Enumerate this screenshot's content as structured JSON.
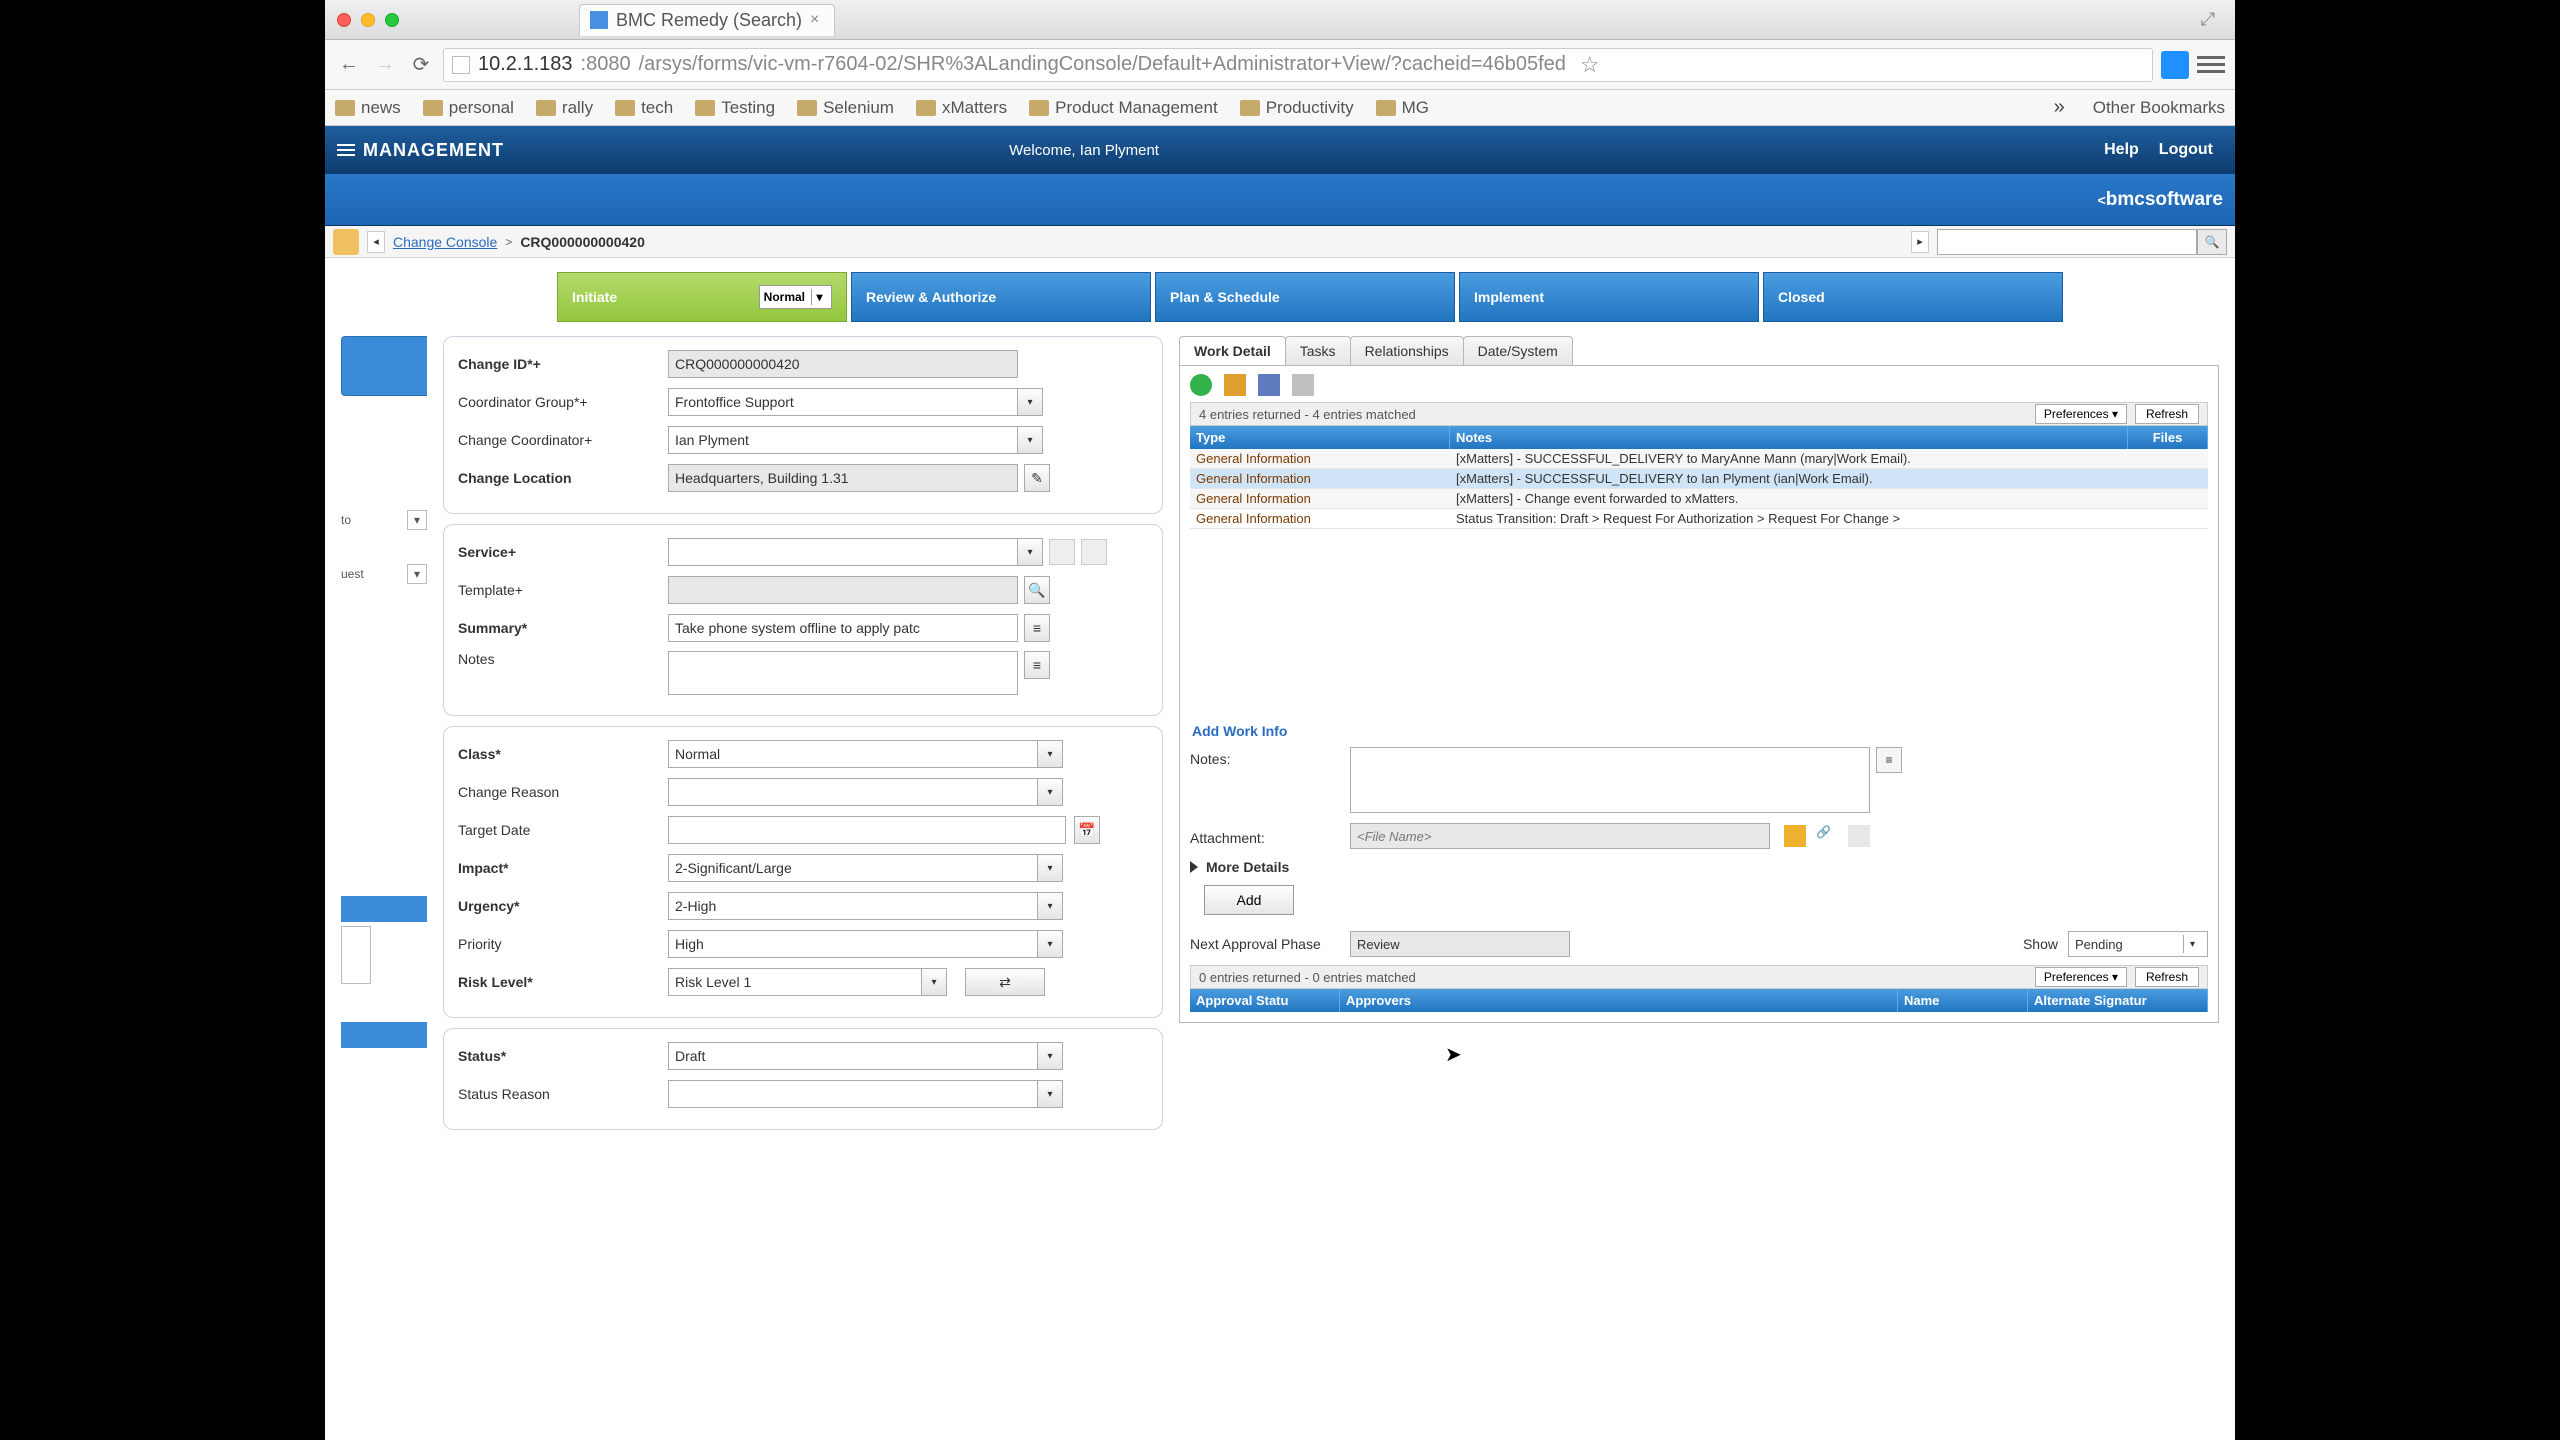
{
  "browser": {
    "tab_title": "BMC Remedy (Search)",
    "url_host": "10.2.1.183",
    "url_port": ":8080",
    "url_rest": "/arsys/forms/vic-vm-r7604-02/SHR%3ALandingConsole/Default+Administrator+View/?cacheid=46b05fed",
    "bookmarks": [
      "news",
      "personal",
      "rally",
      "tech",
      "Testing",
      "Selenium",
      "xMatters",
      "Product Management",
      "Productivity",
      "MG"
    ],
    "more_symbol": "»",
    "other_bookmarks": "Other Bookmarks"
  },
  "header": {
    "app_title": "MANAGEMENT",
    "welcome": "Welcome, Ian Plyment",
    "help": "Help",
    "logout": "Logout",
    "bmc_logo": "bmcsoftware"
  },
  "breadcrumb": {
    "link": "Change Console",
    "current": "CRQ000000000420"
  },
  "pipeline": {
    "stages": [
      "Initiate",
      "Review & Authorize",
      "Plan & Schedule",
      "Implement",
      "Closed"
    ],
    "substage_value": "Normal"
  },
  "left_form": {
    "change_id_label": "Change ID*+",
    "change_id_value": "CRQ000000000420",
    "coord_group_label": "Coordinator Group*+",
    "coord_group_value": "Frontoffice Support",
    "change_coord_label": "Change Coordinator+",
    "change_coord_value": "Ian Plyment",
    "change_loc_label": "Change Location",
    "change_loc_value": "Headquarters, Building 1.31",
    "service_label": "Service+",
    "service_value": "",
    "template_label": "Template+",
    "template_value": "",
    "summary_label": "Summary*",
    "summary_value": "Take phone system offline to apply patc",
    "notes_label": "Notes",
    "notes_value": "",
    "class_label": "Class*",
    "class_value": "Normal",
    "change_reason_label": "Change Reason",
    "change_reason_value": "",
    "target_date_label": "Target Date",
    "target_date_value": "",
    "impact_label": "Impact*",
    "impact_value": "2-Significant/Large",
    "urgency_label": "Urgency*",
    "urgency_value": "2-High",
    "priority_label": "Priority",
    "priority_value": "High",
    "risk_label": "Risk Level*",
    "risk_value": "Risk Level 1",
    "status_label": "Status*",
    "status_value": "Draft",
    "status_reason_label": "Status Reason",
    "status_reason_value": ""
  },
  "leftnav": {
    "item1": "to",
    "item2": "uest"
  },
  "right_tabs": [
    "Work Detail",
    "Tasks",
    "Relationships",
    "Date/System"
  ],
  "work_detail": {
    "count_text": "4 entries returned - 4 entries matched",
    "preferences": "Preferences ▾",
    "refresh": "Refresh",
    "headers": {
      "c1": "Type",
      "c2": "Notes",
      "c3": "Files"
    },
    "rows": [
      {
        "type": "General Information",
        "notes": "[xMatters] - SUCCESSFUL_DELIVERY to MaryAnne Mann (mary|Work Email)."
      },
      {
        "type": "General Information",
        "notes": "[xMatters] - SUCCESSFUL_DELIVERY to Ian Plyment (ian|Work Email).",
        "hl": true
      },
      {
        "type": "General Information",
        "notes": "[xMatters] - Change event forwarded to xMatters."
      },
      {
        "type": "General Information",
        "notes": "Status Transition: Draft > Request For Authorization > Request For Change >"
      }
    ],
    "add_title": "Add Work Info",
    "notes_lbl": "Notes:",
    "attachment_lbl": "Attachment:",
    "file_placeholder": "<File Name>",
    "more_details": "More Details",
    "add_btn": "Add",
    "next_approval_lbl": "Next Approval Phase",
    "next_approval_val": "Review",
    "show_lbl": "Show",
    "show_val": "Pending",
    "approval_count": "0 entries returned - 0 entries matched",
    "approval_headers": {
      "c1": "Approval Statu",
      "c2": "Approvers",
      "c3": "Name",
      "c4": "Alternate Signatur"
    }
  }
}
